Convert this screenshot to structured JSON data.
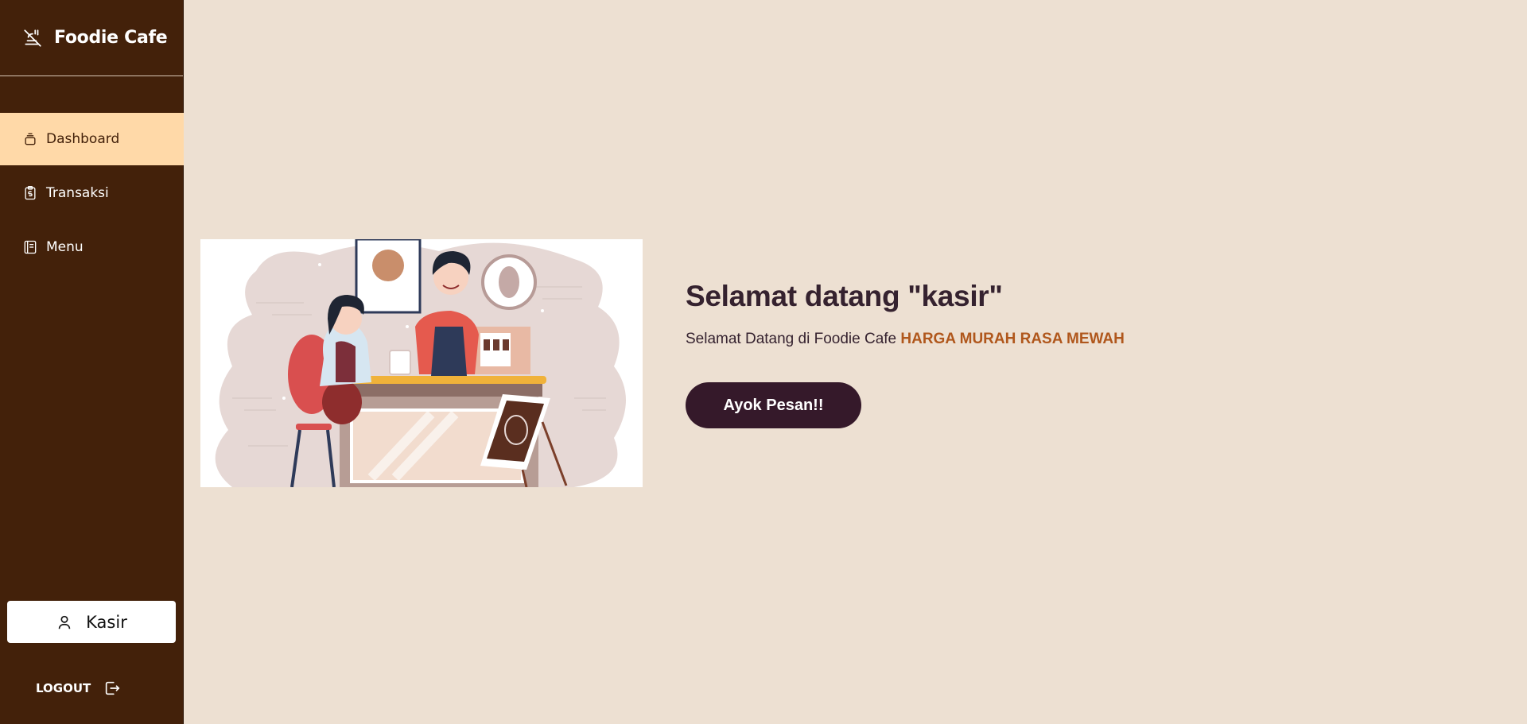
{
  "sidebar": {
    "brand": {
      "title": "Foodie Cafe",
      "icon": "no-food-icon"
    },
    "items": [
      {
        "label": "Dashboard",
        "icon": "layers-icon",
        "active": true
      },
      {
        "label": "Transaksi",
        "icon": "receipt-dollar-icon",
        "active": false
      },
      {
        "label": "Menu",
        "icon": "book-icon",
        "active": false
      }
    ],
    "user": {
      "label": "Kasir",
      "icon": "user-icon"
    },
    "logout": {
      "label": "LOGOUT",
      "icon": "logout-icon"
    }
  },
  "main": {
    "heading": "Selamat datang \"kasir\"",
    "subtitle_prefix": "Selamat Datang di Foodie Cafe",
    "subtitle_highlight": "HARGA MURAH RASA MEWAH",
    "cta_label": "Ayok Pesan!!"
  },
  "colors": {
    "sidebar_bg": "#43210A",
    "page_bg": "#EDE0D2",
    "active_item_bg": "#FFD9A8",
    "accent": "#B0571C",
    "cta_bg": "#35192A"
  }
}
